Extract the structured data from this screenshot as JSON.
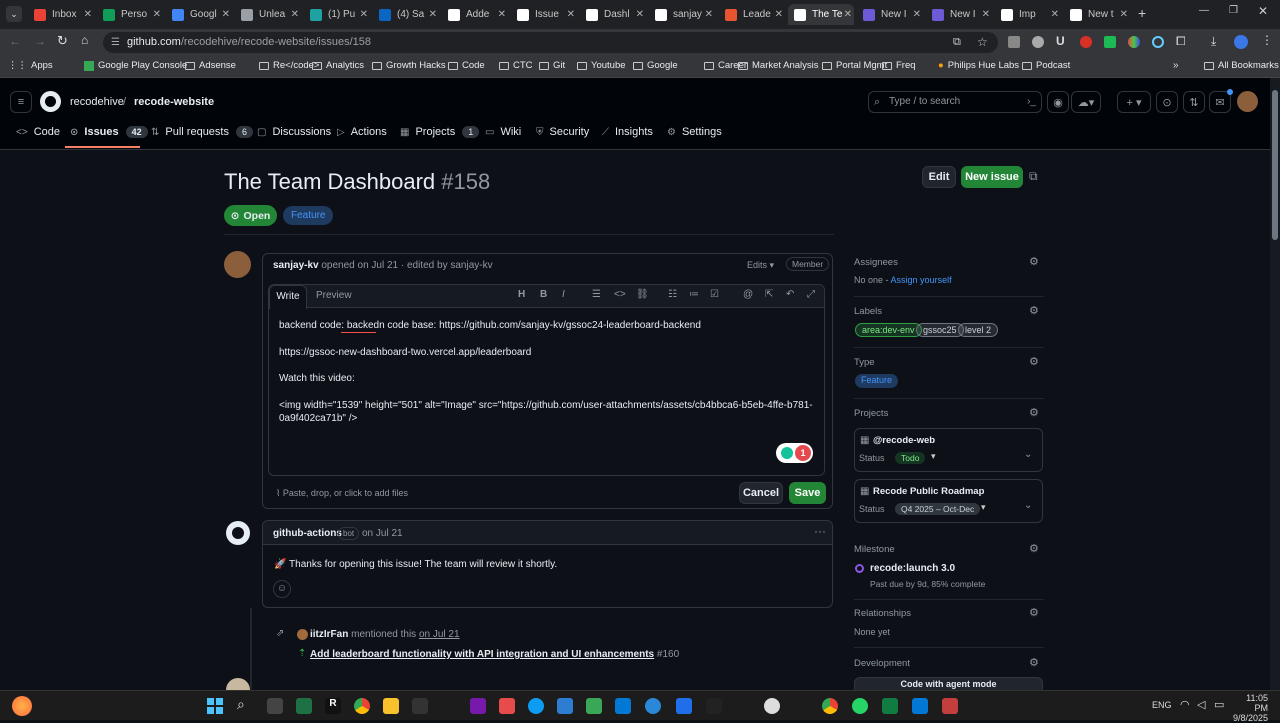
{
  "browser": {
    "tabs": [
      {
        "label": "Inbox",
        "color": "#ea4335"
      },
      {
        "label": "Perso",
        "color": "#0f9d58"
      },
      {
        "label": "Googl",
        "color": "#4285f4"
      },
      {
        "label": "Unlea",
        "color": "#9aa0a6"
      },
      {
        "label": "(1) Pu",
        "color": "#1da1a1"
      },
      {
        "label": "(4) Sa",
        "color": "#0a66c2"
      },
      {
        "label": "Adde",
        "color": "#ffffff"
      },
      {
        "label": "Issue",
        "color": "#ffffff"
      },
      {
        "label": "Dashl",
        "color": "#ffffff"
      },
      {
        "label": "sanjay",
        "color": "#ffffff"
      },
      {
        "label": "Leade",
        "color": "#e8542f"
      },
      {
        "label": "The Te",
        "color": "#ffffff"
      },
      {
        "label": "New I",
        "color": "#6b5bd6"
      },
      {
        "label": "New I",
        "color": "#6b5bd6"
      },
      {
        "label": "Imp",
        "color": "#ffffff"
      },
      {
        "label": "New t",
        "color": "#ffffff"
      }
    ],
    "url_host": "github.com",
    "url_path": "/recodehive/recode-website/issues/158",
    "bookmarks": [
      "Apps",
      "Google Play Console",
      "Adsense",
      "Re</code>",
      "Analytics",
      "Growth Hacks",
      "Code",
      "CTC",
      "Git",
      "Youtube",
      "Google",
      "Career",
      "Market Analysis",
      "Portal Mgmt",
      "Freq",
      "Philips Hue Labs",
      "Podcast"
    ],
    "all_bookmarks": "All Bookmarks"
  },
  "repo": {
    "owner": "recodehive",
    "separator": "/",
    "name": "recode-website",
    "search_placeholder": "Type / to search"
  },
  "nav": [
    {
      "label": "Code",
      "count": ""
    },
    {
      "label": "Issues",
      "count": "42"
    },
    {
      "label": "Pull requests",
      "count": "6"
    },
    {
      "label": "Discussions",
      "count": ""
    },
    {
      "label": "Actions",
      "count": ""
    },
    {
      "label": "Projects",
      "count": "1"
    },
    {
      "label": "Wiki",
      "count": ""
    },
    {
      "label": "Security",
      "count": ""
    },
    {
      "label": "Insights",
      "count": ""
    },
    {
      "label": "Settings",
      "count": ""
    }
  ],
  "issue": {
    "title": "The Team Dashboard",
    "number": "#158",
    "state": "Open",
    "type": "Feature",
    "edit_label": "Edit",
    "new_issue_label": "New issue",
    "author": "sanjay-kv",
    "meta": "opened on Jul 21 · edited by sanjay-kv",
    "edits_label": "Edits",
    "role_badge": "Member",
    "editor": {
      "write_tab": "Write",
      "preview_tab": "Preview",
      "line1": "backend code: backedn code base: https://github.com/sanjay-kv/gssoc24-leaderboard-backend",
      "line2": "https://gssoc-new-dashboard-two.vercel.app/leaderboard",
      "line3": "Watch this video:",
      "line4": "<img width=\"1539\" height=\"501\" alt=\"Image\" src=\"https://github.com/user-attachments/assets/cb4bbca6-b5eb-4ffe-b781-",
      "line5": "0a9f402ca71b\" />",
      "grammar_count": "1",
      "attach_hint": "Paste, drop, or click to add files",
      "cancel_label": "Cancel",
      "save_label": "Save"
    },
    "bot_comment": {
      "author": "github-actions",
      "badge": "bot",
      "date": "on Jul 21",
      "text": "🚀 Thanks for opening this issue! The team will review it shortly."
    },
    "mention": {
      "user": "iitzIrFan",
      "action": "mentioned this",
      "date": "on Jul 21",
      "pr_title": "Add leaderboard functionality with API integration and UI enhancements",
      "pr_number": "#160"
    }
  },
  "sidebar": {
    "assignees_title": "Assignees",
    "assignees_value": "No one -",
    "assign_yourself": "Assign yourself",
    "labels_title": "Labels",
    "labels": [
      {
        "name": "area:dev-env",
        "color": "#2ea043"
      },
      {
        "name": "gssoc25",
        "color": "#6e7681"
      },
      {
        "name": "level 2",
        "color": "#6e7681"
      }
    ],
    "type_title": "Type",
    "type_value": "Feature",
    "projects_title": "Projects",
    "projects": [
      {
        "name": "@recode-web",
        "status_label": "Status",
        "status": "Todo"
      },
      {
        "name": "Recode Public Roadmap",
        "status_label": "Status",
        "status": "Q4 2025 – Oct-Dec"
      }
    ],
    "milestone_title": "Milestone",
    "milestone_name": "recode:launch 3.0",
    "milestone_meta": "Past due by 9d, 85% complete",
    "relationships_title": "Relationships",
    "relationships_value": "None yet",
    "development_title": "Development",
    "development_button": "Code with agent mode"
  },
  "system": {
    "time": "11:05 PM",
    "date": "9/8/2025",
    "lang": "ENG"
  }
}
